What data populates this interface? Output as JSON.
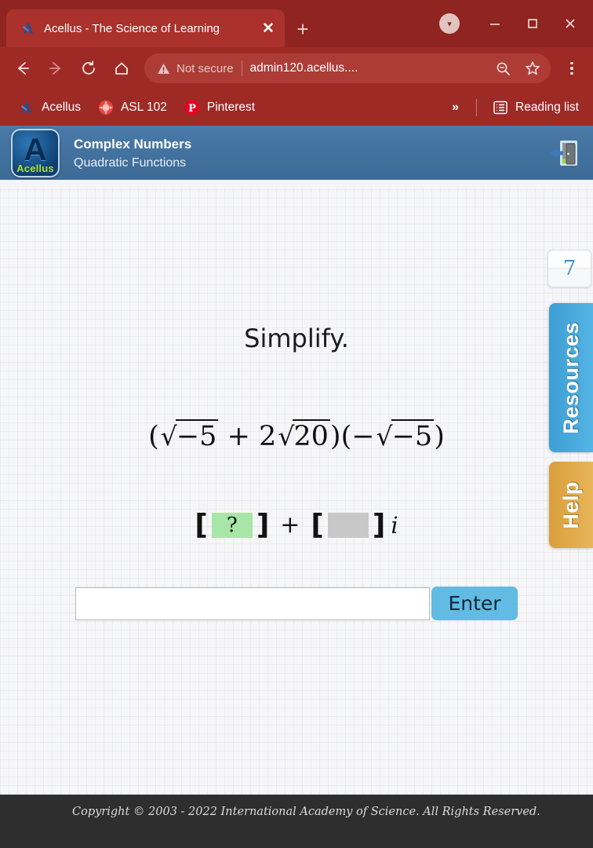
{
  "browser": {
    "tab": {
      "favicon": "acellus-logo-icon",
      "title": "Acellus - The Science of Learning",
      "close_label": "✕"
    },
    "new_tab_label": "+",
    "window_controls": {
      "download_label": "▾",
      "minimize_label": "—",
      "maximize_label": "□",
      "close_label": "✕"
    },
    "nav": {
      "back": "back-arrow-icon",
      "forward": "forward-arrow-icon",
      "reload": "reload-icon",
      "home": "home-icon"
    },
    "omnibox": {
      "security_label": "Not secure",
      "url": "admin120.acellus....",
      "zoom_icon": "zoom-out-icon",
      "bookmark_icon": "star-icon"
    },
    "bookmarks": [
      {
        "label": "Acellus",
        "icon": "acellus-logo-icon"
      },
      {
        "label": "ASL 102",
        "icon": "asl-circle-icon"
      },
      {
        "label": "Pinterest",
        "icon": "pinterest-icon"
      }
    ],
    "overflow_label": "»",
    "reading_list_label": "Reading list"
  },
  "acellus": {
    "header": {
      "logo_letter": "A",
      "logo_word": "Acellus",
      "title": "Complex Numbers",
      "subtitle": "Quadratic Functions",
      "exit_icon": "exit-door-icon"
    },
    "question": {
      "prompt": "Simplify.",
      "expression": {
        "open_paren": "(",
        "term1_radical": "√",
        "term1_radicand": "−5",
        "operator": "+",
        "term2_coefficient": "2",
        "term2_radical": "√",
        "term2_radicand": "20",
        "close_paren": ")",
        "open_paren2": "(",
        "term3_sign": "−",
        "term3_radical": "√",
        "term3_radicand": "−5",
        "close_paren2": ")",
        "plain_text": "(√−5 + 2√20)(−√−5)"
      },
      "answer_template": {
        "left_bracket": "[",
        "real_slot_value": "?",
        "right_bracket": "]",
        "plus": "+",
        "left_bracket2": "[",
        "imag_slot_value": "",
        "right_bracket2": "]",
        "imaginary_unit": "i",
        "active_slot_color": "#a8e6a8",
        "inactive_slot_color": "#c8c8c8"
      }
    },
    "entry": {
      "input_value": "",
      "input_placeholder": "",
      "enter_label": "Enter",
      "enter_color": "#62bbe2"
    },
    "rail": {
      "counter_value": "7",
      "resources_label": "Resources",
      "resources_color": "#3d9ed4",
      "help_label": "Help",
      "help_color": "#d99f3c"
    },
    "footer": {
      "copyright": "Copyright © 2003 - 2022 International Academy of Science.  All Rights Reserved."
    }
  }
}
